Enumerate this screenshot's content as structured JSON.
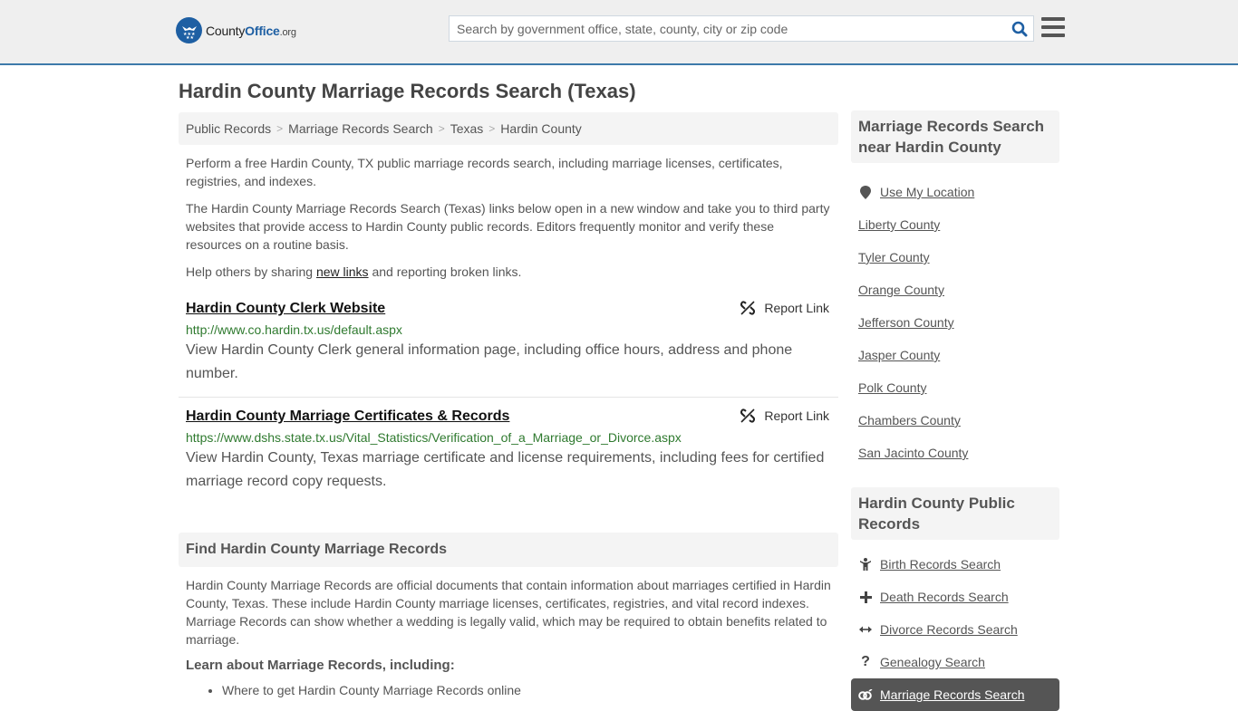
{
  "header": {
    "logo": {
      "brand_prefix": "County",
      "brand_main": "Office",
      "brand_suffix": ".org"
    },
    "search": {
      "placeholder": "Search by government office, state, county, city or zip code",
      "value": ""
    },
    "colors": {
      "accent": "#1e5fa3",
      "header_border": "#3d7aaa",
      "url_green": "#2f7a2f"
    }
  },
  "page": {
    "title": "Hardin County Marriage Records Search (Texas)"
  },
  "breadcrumb": [
    "Public Records",
    "Marriage Records Search",
    "Texas",
    "Hardin County"
  ],
  "intro": {
    "p1": "Perform a free Hardin County, TX public marriage records search, including marriage licenses, certificates, registries, and indexes.",
    "p2": "The Hardin County Marriage Records Search (Texas) links below open in a new window and take you to third party websites that provide access to Hardin County public records. Editors frequently monitor and verify these resources on a routine basis.",
    "p3_before": "Help others by sharing ",
    "p3_link": "new links",
    "p3_after": " and reporting broken links."
  },
  "results": [
    {
      "title": "Hardin County Clerk Website",
      "url": "http://www.co.hardin.tx.us/default.aspx",
      "description": "View Hardin County Clerk general information page, including office hours, address and phone number.",
      "report_label": "Report Link"
    },
    {
      "title": "Hardin County Marriage Certificates & Records",
      "url": "https://www.dshs.state.tx.us/Vital_Statistics/Verification_of_a_Marriage_or_Divorce.aspx",
      "description": "View Hardin County, Texas marriage certificate and license requirements, including fees for certified marriage record copy requests.",
      "report_label": "Report Link"
    }
  ],
  "find_section": {
    "heading": "Find Hardin County Marriage Records",
    "body": "Hardin County Marriage Records are official documents that contain information about marriages certified in Hardin County, Texas. These include Hardin County marriage licenses, certificates, registries, and vital record indexes. Marriage Records can show whether a wedding is legally valid, which may be required to obtain benefits related to marriage.",
    "learn_heading": "Learn about Marriage Records, including:",
    "learn_items": [
      "Where to get Hardin County Marriage Records online"
    ]
  },
  "sidebar": {
    "near_heading": "Marriage Records Search near Hardin County",
    "use_location": "Use My Location",
    "near_counties": [
      "Liberty County",
      "Tyler County",
      "Orange County",
      "Jefferson County",
      "Jasper County",
      "Polk County",
      "Chambers County",
      "San Jacinto County"
    ],
    "public_heading": "Hardin County Public Records",
    "public_links": [
      {
        "label": "Birth Records Search",
        "icon": "child-icon"
      },
      {
        "label": "Death Records Search",
        "icon": "plus-icon"
      },
      {
        "label": "Divorce Records Search",
        "icon": "arrows-h-icon"
      },
      {
        "label": "Genealogy Search",
        "icon": "question-icon"
      }
    ],
    "active_link": {
      "label": "Marriage Records Search",
      "icon": "rings-icon"
    }
  }
}
